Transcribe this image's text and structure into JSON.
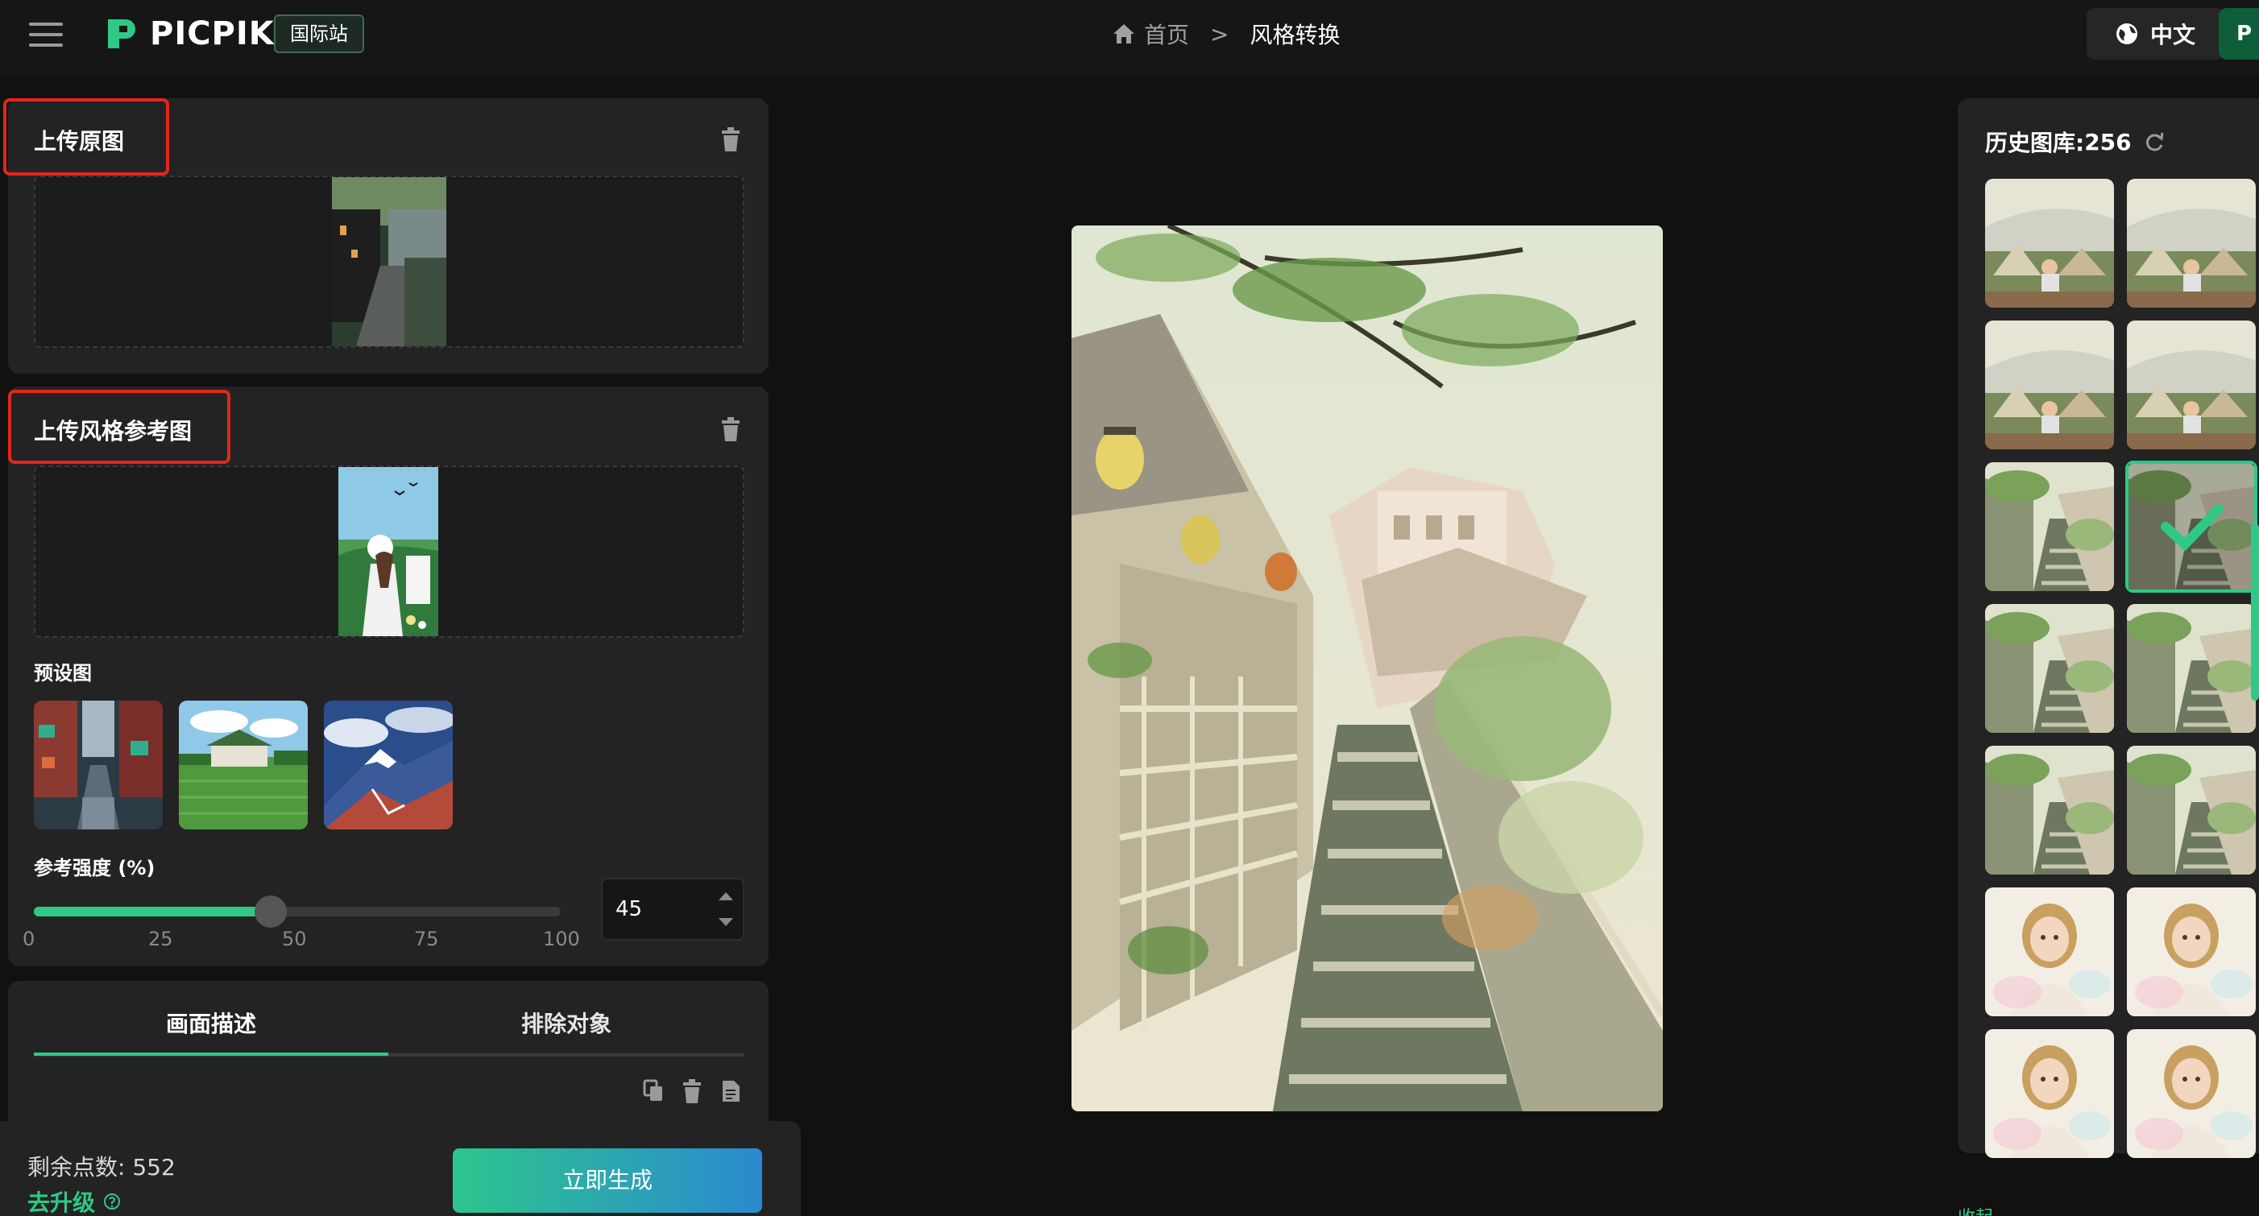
{
  "app": {
    "brand": "PICPIK",
    "site_badge": "国际站",
    "accent_color": "#2ec987"
  },
  "breadcrumb": {
    "home": "首页",
    "separator": ">",
    "current": "风格转换"
  },
  "header_right": {
    "language": "中文",
    "avatar_initial": "P"
  },
  "left": {
    "upload_original_title": "上传原图",
    "upload_style_title": "上传风格参考图",
    "preset_label": "预设图",
    "presets": [
      {
        "name": "city-rain-street"
      },
      {
        "name": "green-farm-field"
      },
      {
        "name": "snow-mountain"
      }
    ],
    "strength_label": "参考强度 (%)",
    "strength_value": 45,
    "strength_ticks": [
      "0",
      "25",
      "50",
      "75",
      "100"
    ],
    "tabs": [
      "画面描述",
      "排除对象"
    ],
    "active_tab": 0
  },
  "bottom": {
    "points_label": "剩余点数: ",
    "points_value": "552",
    "upgrade_label": "去升级",
    "generate_label": "立即生成"
  },
  "history": {
    "title": "历史图库: ",
    "count": "256",
    "selected_index": 5,
    "items": [
      {
        "theme": "tent-camping"
      },
      {
        "theme": "tent-camping"
      },
      {
        "theme": "tent-camping"
      },
      {
        "theme": "tent-camping"
      },
      {
        "theme": "watercolor-alley"
      },
      {
        "theme": "watercolor-alley"
      },
      {
        "theme": "watercolor-alley"
      },
      {
        "theme": "watercolor-alley"
      },
      {
        "theme": "watercolor-alley"
      },
      {
        "theme": "watercolor-alley"
      },
      {
        "theme": "girl-portrait"
      },
      {
        "theme": "girl-portrait"
      },
      {
        "theme": "girl-portrait"
      },
      {
        "theme": "girl-portrait"
      }
    ],
    "collapse_label": "收起"
  }
}
